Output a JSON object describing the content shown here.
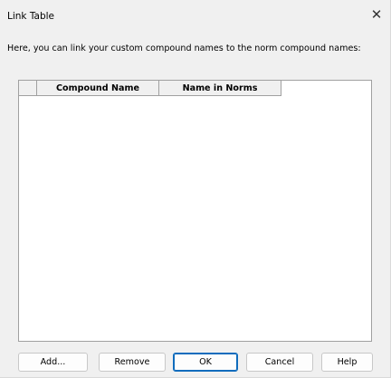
{
  "window": {
    "title": "Link Table",
    "close_icon": "close-icon"
  },
  "description": "Here, you can link your custom compound names to the norm compound names:",
  "table": {
    "columns": [
      "",
      "Compound Name",
      "Name in Norms"
    ],
    "rows": []
  },
  "buttons": {
    "add": "Add...",
    "remove": "Remove",
    "ok": "OK",
    "cancel": "Cancel",
    "help": "Help"
  },
  "colors": {
    "accent": "#0f6cbd"
  }
}
